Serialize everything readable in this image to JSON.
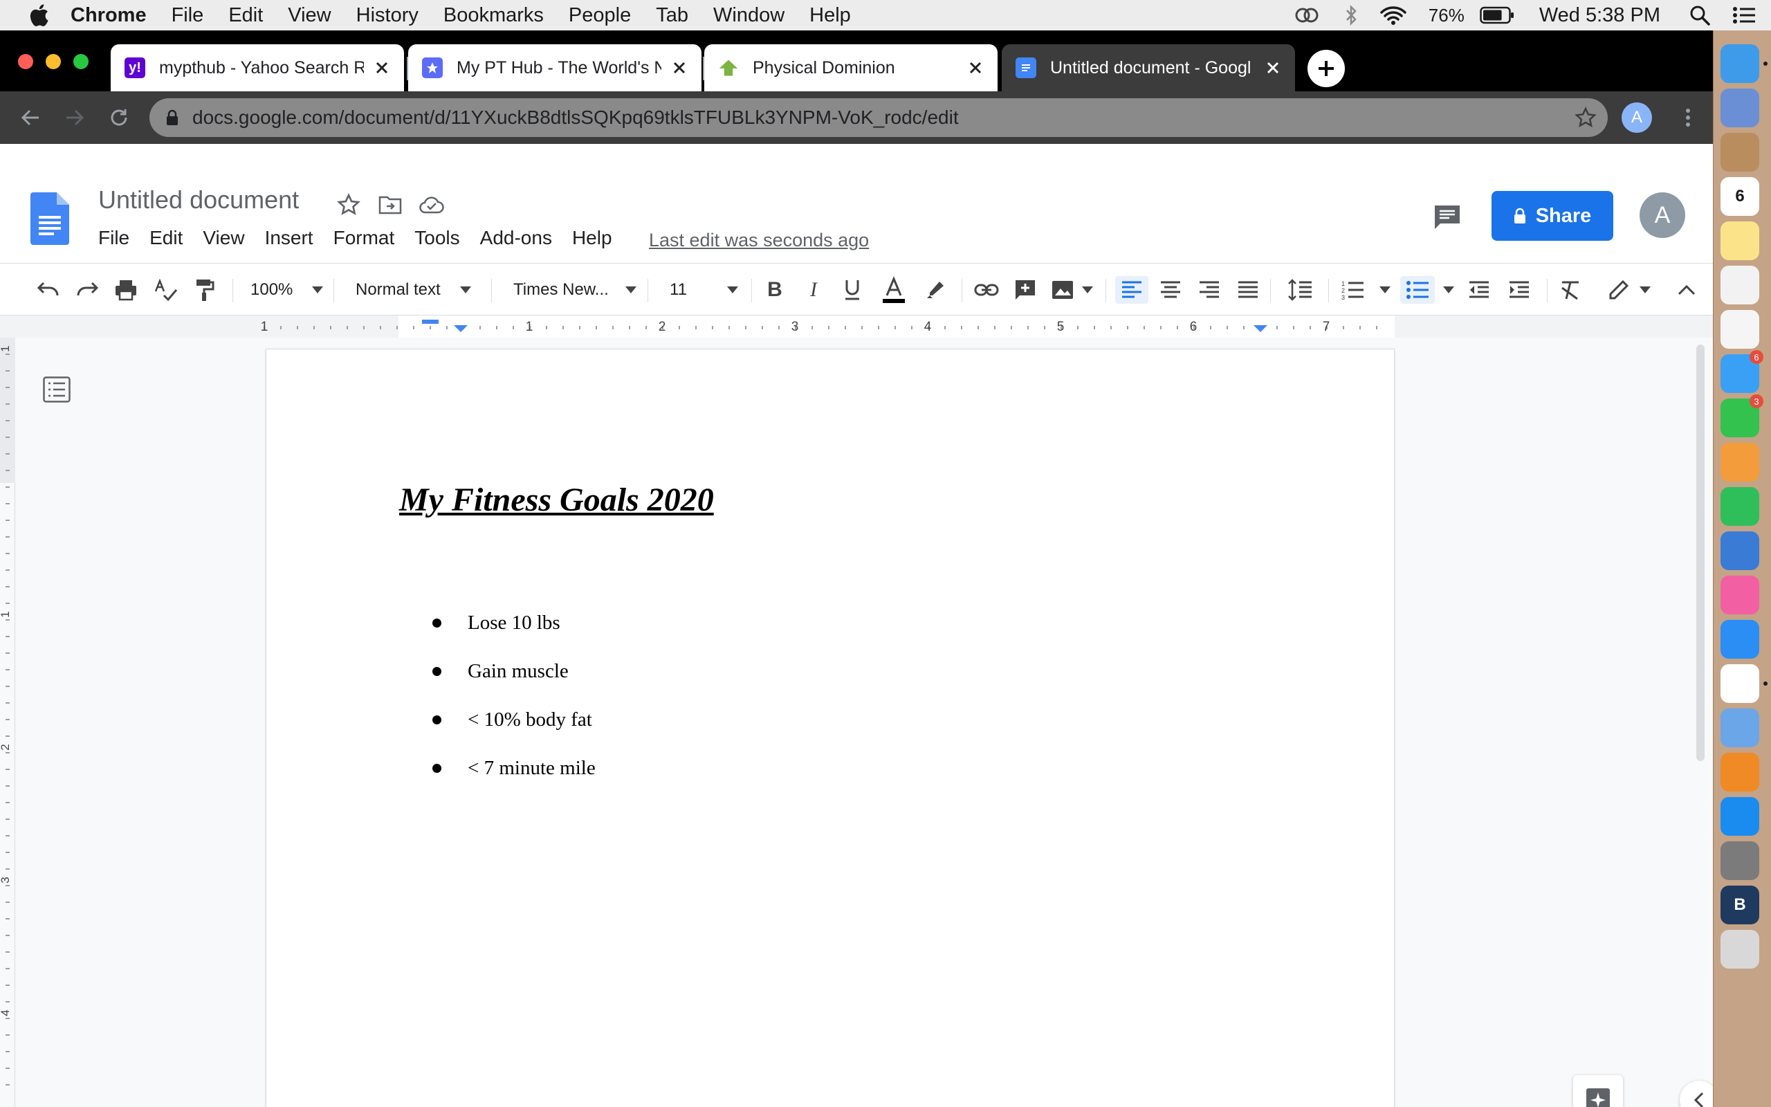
{
  "menubar": {
    "app_name": "Chrome",
    "items": [
      "File",
      "Edit",
      "View",
      "History",
      "Bookmarks",
      "People",
      "Tab",
      "Window",
      "Help"
    ],
    "battery_percent": "76%",
    "battery_level": 0.76,
    "clock": "Wed 5:38 PM",
    "icons": [
      "creative-cloud-icon",
      "bluetooth-icon",
      "wifi-icon",
      "battery-icon",
      "spotlight-icon",
      "control-center-icon"
    ]
  },
  "tabs": [
    {
      "title": "mypthub - Yahoo Search R",
      "favicon": "yahoo-icon",
      "color": "#6001d2",
      "active": false
    },
    {
      "title": "My PT Hub - The World's N",
      "favicon": "pthub-icon",
      "color": "#5b6cf9",
      "active": false
    },
    {
      "title": "Physical Dominion",
      "favicon": "physical-dominion-icon",
      "color": "#7cb342",
      "active": false
    },
    {
      "title": "Untitled document - Googl",
      "favicon": "google-docs-icon",
      "color": "#4285f4",
      "active": true
    }
  ],
  "address_bar": {
    "url": "docs.google.com/document/d/11YXuckB8dtlsSQKpq69tklsTFUBLk3YNPM-VoK_rodc/edit"
  },
  "chrome_profile_initial": "A",
  "docs": {
    "title": "Untitled document",
    "menu": [
      "File",
      "Edit",
      "View",
      "Insert",
      "Format",
      "Tools",
      "Add-ons",
      "Help"
    ],
    "last_edit": "Last edit was seconds ago",
    "share_label": "Share",
    "account_initial": "A",
    "accent": "#1a73e8"
  },
  "toolbar": {
    "zoom": "100%",
    "style": "Normal text",
    "font": "Times New...",
    "font_size": "11"
  },
  "ruler": {
    "labels": [
      "1",
      "1",
      "2",
      "3",
      "4",
      "5",
      "6",
      "7"
    ],
    "vertical_labels": [
      "1",
      "1",
      "2",
      "3",
      "4"
    ]
  },
  "document": {
    "heading": "My Fitness Goals 2020",
    "bullets": [
      "Lose 10 lbs",
      "Gain muscle",
      "< 10% body fat",
      "< 7 minute mile"
    ]
  },
  "dock": {
    "apps": [
      {
        "name": "finder",
        "color": "#3d9be9",
        "running": true
      },
      {
        "name": "mail",
        "color": "#6b8fd4"
      },
      {
        "name": "contacts",
        "color": "#b98d5e"
      },
      {
        "name": "calendar",
        "color": "#ffffff",
        "text": "6"
      },
      {
        "name": "notes",
        "color": "#fbe38a"
      },
      {
        "name": "reminders",
        "color": "#f2f2f2"
      },
      {
        "name": "photos",
        "color": "#f5f5f5"
      },
      {
        "name": "messages",
        "color": "#3aa0f5",
        "badge": "6"
      },
      {
        "name": "facetime",
        "color": "#32c24d",
        "badge": "3"
      },
      {
        "name": "pages",
        "color": "#f39c3c"
      },
      {
        "name": "numbers",
        "color": "#2fbf5a"
      },
      {
        "name": "keynote",
        "color": "#3a7bd5"
      },
      {
        "name": "itunes",
        "color": "#f35fa3"
      },
      {
        "name": "safari",
        "color": "#2a8ef5"
      },
      {
        "name": "chrome",
        "color": "#ffffff",
        "running": true
      },
      {
        "name": "network",
        "color": "#6aa6e8"
      },
      {
        "name": "ibooks",
        "color": "#f08a24"
      },
      {
        "name": "app-store",
        "color": "#1a8cf0"
      },
      {
        "name": "system-preferences",
        "color": "#7b7b7b"
      },
      {
        "name": "b-app",
        "color": "#1f3a5f",
        "text": "B"
      },
      {
        "name": "trash",
        "color": "#d8d8d8"
      }
    ]
  }
}
